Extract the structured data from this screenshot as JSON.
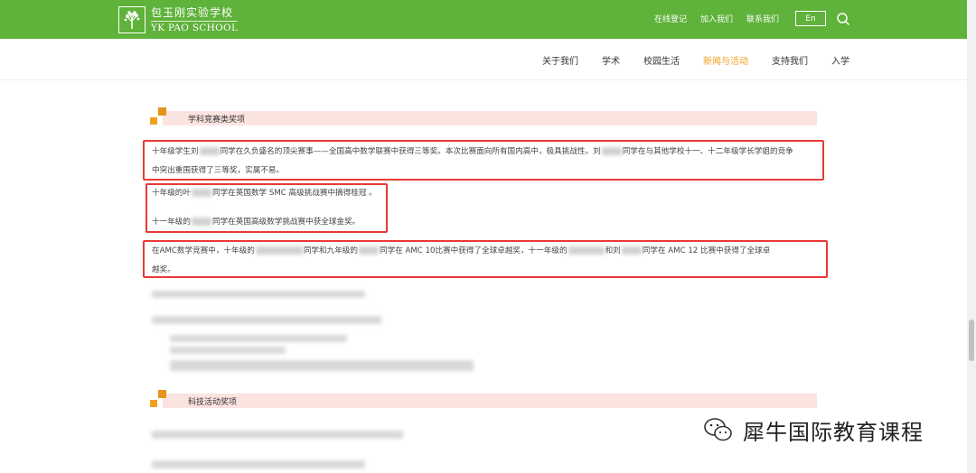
{
  "header": {
    "logo_cn": "包玉刚实验学校",
    "logo_en": "YK PAO SCHOOL",
    "links": [
      "在线登记",
      "加入我们",
      "联系我们"
    ],
    "lang": "En"
  },
  "nav": {
    "items": [
      "关于我们",
      "学术",
      "校园生活",
      "新闻与活动",
      "支持我们",
      "入学"
    ],
    "active": "新闻与活动"
  },
  "sections": {
    "competition_title": "学科竞赛类奖项",
    "tech_title": "科技活动奖项"
  },
  "paragraphs": {
    "p1_a": "十年级学生刘",
    "p1_b": "同学在久负盛名的顶尖赛事——全国高中数学联赛中获得三等奖。本次比赛面向所有国内高中，极具挑战性。刘",
    "p1_c": "同学在与其他学校十一、十二年级学长学姐的竞争",
    "p1_d": "中突出重围获得了三等奖，实属不易。",
    "p2_a": "十年级的叶",
    "p2_b": "同学在英国数学 SMC 高级挑战赛中摘得桂冠 。",
    "p3_a": "十一年级的",
    "p3_b": "同学在英国高级数学挑战赛中获全球金奖。",
    "p4_a": "在AMC数学竞赛中，十年级的",
    "p4_b": "同学和九年级的",
    "p4_c": "同学在 AMC 10比赛中获得了全球卓越奖，十一年级的",
    "p4_d": "和刘",
    "p4_e": "同学在 AMC 12 比赛中获得了全球卓",
    "p4_f": "越奖。"
  },
  "watermark": {
    "text": "犀牛国际教育课程"
  },
  "colors": {
    "green": "#5fb23a",
    "accent": "#f0a020",
    "red": "#e83a36"
  }
}
